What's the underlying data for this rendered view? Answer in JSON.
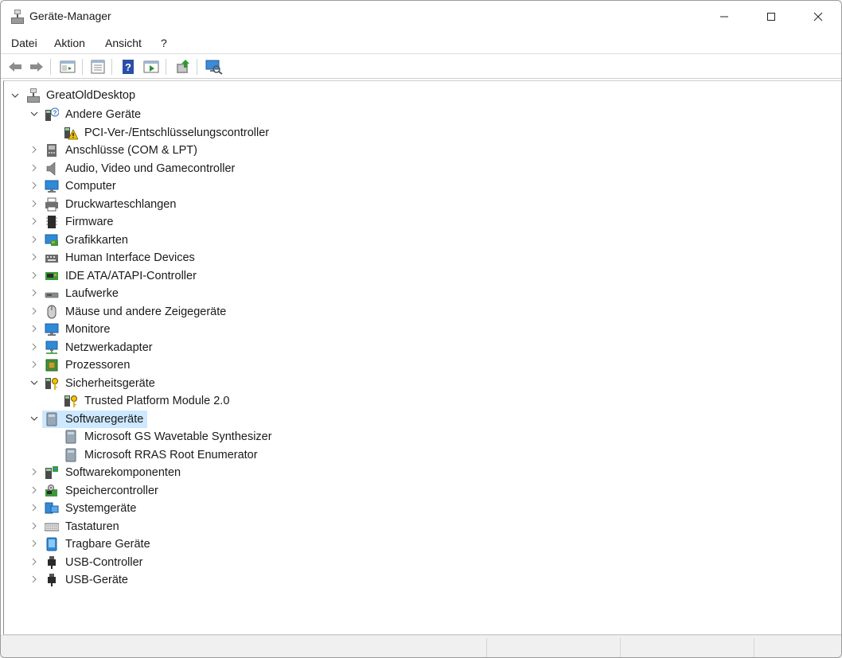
{
  "window": {
    "title": "Geräte-Manager"
  },
  "menu": [
    {
      "label": "Datei"
    },
    {
      "label": "Aktion"
    },
    {
      "label": "Ansicht"
    },
    {
      "label": "?"
    }
  ],
  "toolbar": {
    "buttons": [
      "back-icon",
      "forward-icon",
      "properties-pane-icon",
      "properties-icon",
      "help-icon",
      "run-icon",
      "update-driver-icon",
      "scan-hardware-icon"
    ]
  },
  "tree": {
    "root": "GreatOldDesktop",
    "items": [
      {
        "label": "Andere Geräte",
        "expanded": true,
        "icon": "unknown-device-icon"
      },
      {
        "label": "PCI-Ver-/Entschlüsselungscontroller",
        "child": true,
        "icon": "warning-device-icon"
      },
      {
        "label": "Anschlüsse (COM & LPT)",
        "icon": "port-icon"
      },
      {
        "label": "Audio, Video und Gamecontroller",
        "icon": "speaker-icon"
      },
      {
        "label": "Computer",
        "icon": "computer-icon"
      },
      {
        "label": "Druckwarteschlangen",
        "icon": "printer-icon"
      },
      {
        "label": "Firmware",
        "icon": "firmware-icon"
      },
      {
        "label": "Grafikkarten",
        "icon": "graphics-card-icon"
      },
      {
        "label": "Human Interface Devices",
        "icon": "hid-icon"
      },
      {
        "label": "IDE ATA/ATAPI-Controller",
        "icon": "ide-controller-icon"
      },
      {
        "label": "Laufwerke",
        "icon": "drive-icon"
      },
      {
        "label": "Mäuse und andere Zeigegeräte",
        "icon": "mouse-icon"
      },
      {
        "label": "Monitore",
        "icon": "monitor-icon"
      },
      {
        "label": "Netzwerkadapter",
        "icon": "network-icon"
      },
      {
        "label": "Prozessoren",
        "icon": "processor-icon"
      },
      {
        "label": "Sicherheitsgeräte",
        "expanded": true,
        "icon": "security-device-icon"
      },
      {
        "label": "Trusted Platform Module 2.0",
        "child": true,
        "icon": "tpm-icon"
      },
      {
        "label": "Softwaregeräte",
        "expanded": true,
        "selected": true,
        "icon": "software-device-icon"
      },
      {
        "label": "Microsoft GS Wavetable Synthesizer",
        "child": true,
        "icon": "software-device-icon"
      },
      {
        "label": "Microsoft RRAS Root Enumerator",
        "child": true,
        "icon": "software-device-icon"
      },
      {
        "label": "Softwarekomponenten",
        "icon": "software-component-icon"
      },
      {
        "label": "Speichercontroller",
        "icon": "storage-controller-icon"
      },
      {
        "label": "Systemgeräte",
        "icon": "system-device-icon"
      },
      {
        "label": "Tastaturen",
        "icon": "keyboard-icon"
      },
      {
        "label": "Tragbare Geräte",
        "icon": "portable-device-icon"
      },
      {
        "label": "USB-Controller",
        "icon": "usb-icon"
      },
      {
        "label": "USB-Geräte",
        "icon": "usb-icon"
      }
    ]
  },
  "colors": {
    "selection": "#cde8ff",
    "accent": "#0078d4"
  }
}
